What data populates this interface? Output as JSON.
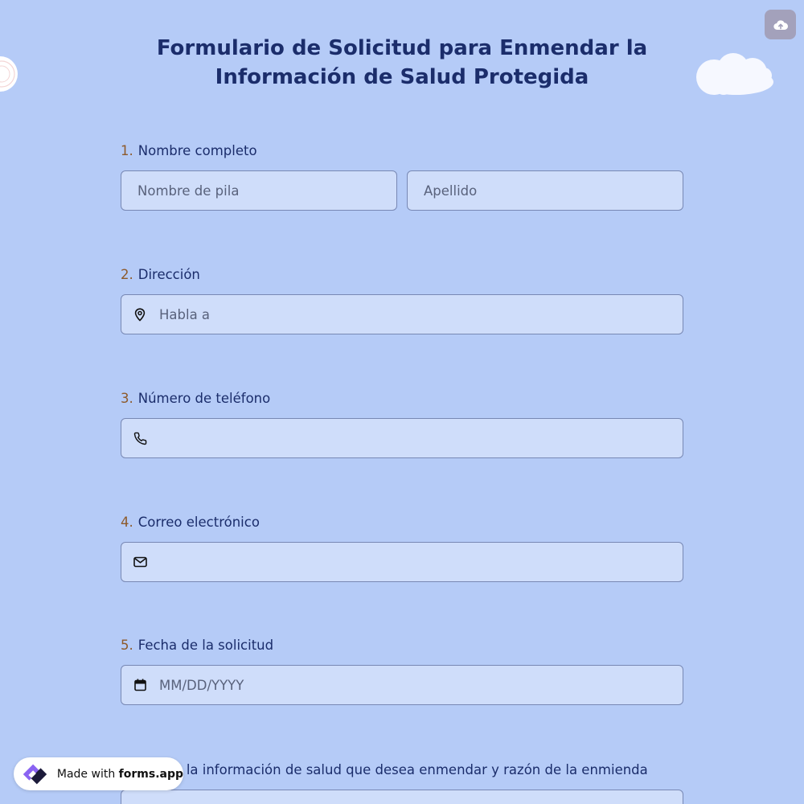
{
  "form": {
    "title": "Formulario de Solicitud para Enmendar la Información de Salud Protegida"
  },
  "questions": [
    {
      "number": "1.",
      "label": "Nombre completo",
      "fields": [
        {
          "placeholder": "Nombre de pila",
          "value": ""
        },
        {
          "placeholder": "Apellido",
          "value": ""
        }
      ]
    },
    {
      "number": "2.",
      "label": "Dirección",
      "icon": "location-pin-icon",
      "placeholder": "Habla a",
      "value": ""
    },
    {
      "number": "3.",
      "label": "Número de teléfono",
      "icon": "phone-icon",
      "placeholder": "",
      "value": ""
    },
    {
      "number": "4.",
      "label": "Correo electrónico",
      "icon": "envelope-icon",
      "placeholder": "",
      "value": ""
    },
    {
      "number": "5.",
      "label": "Fecha de la solicitud",
      "icon": "calendar-icon",
      "placeholder": "MM/DD/YYYY",
      "value": ""
    },
    {
      "label": "…ción de la información de salud que desea enmendar y razón de la enmienda"
    }
  ],
  "badge": {
    "prefix": "Made with",
    "brand": "forms.app",
    "icon": "forms-app-logo-icon"
  },
  "toolbar": {
    "upload_icon": "cloud-upload-icon"
  },
  "colors": {
    "background": "#b5cbf7",
    "field_background": "#cfddfa",
    "field_border": "#7888b4",
    "title": "#1b2d6b",
    "question_number": "#8d5a2b",
    "upload_button": "#a3a1bb"
  }
}
